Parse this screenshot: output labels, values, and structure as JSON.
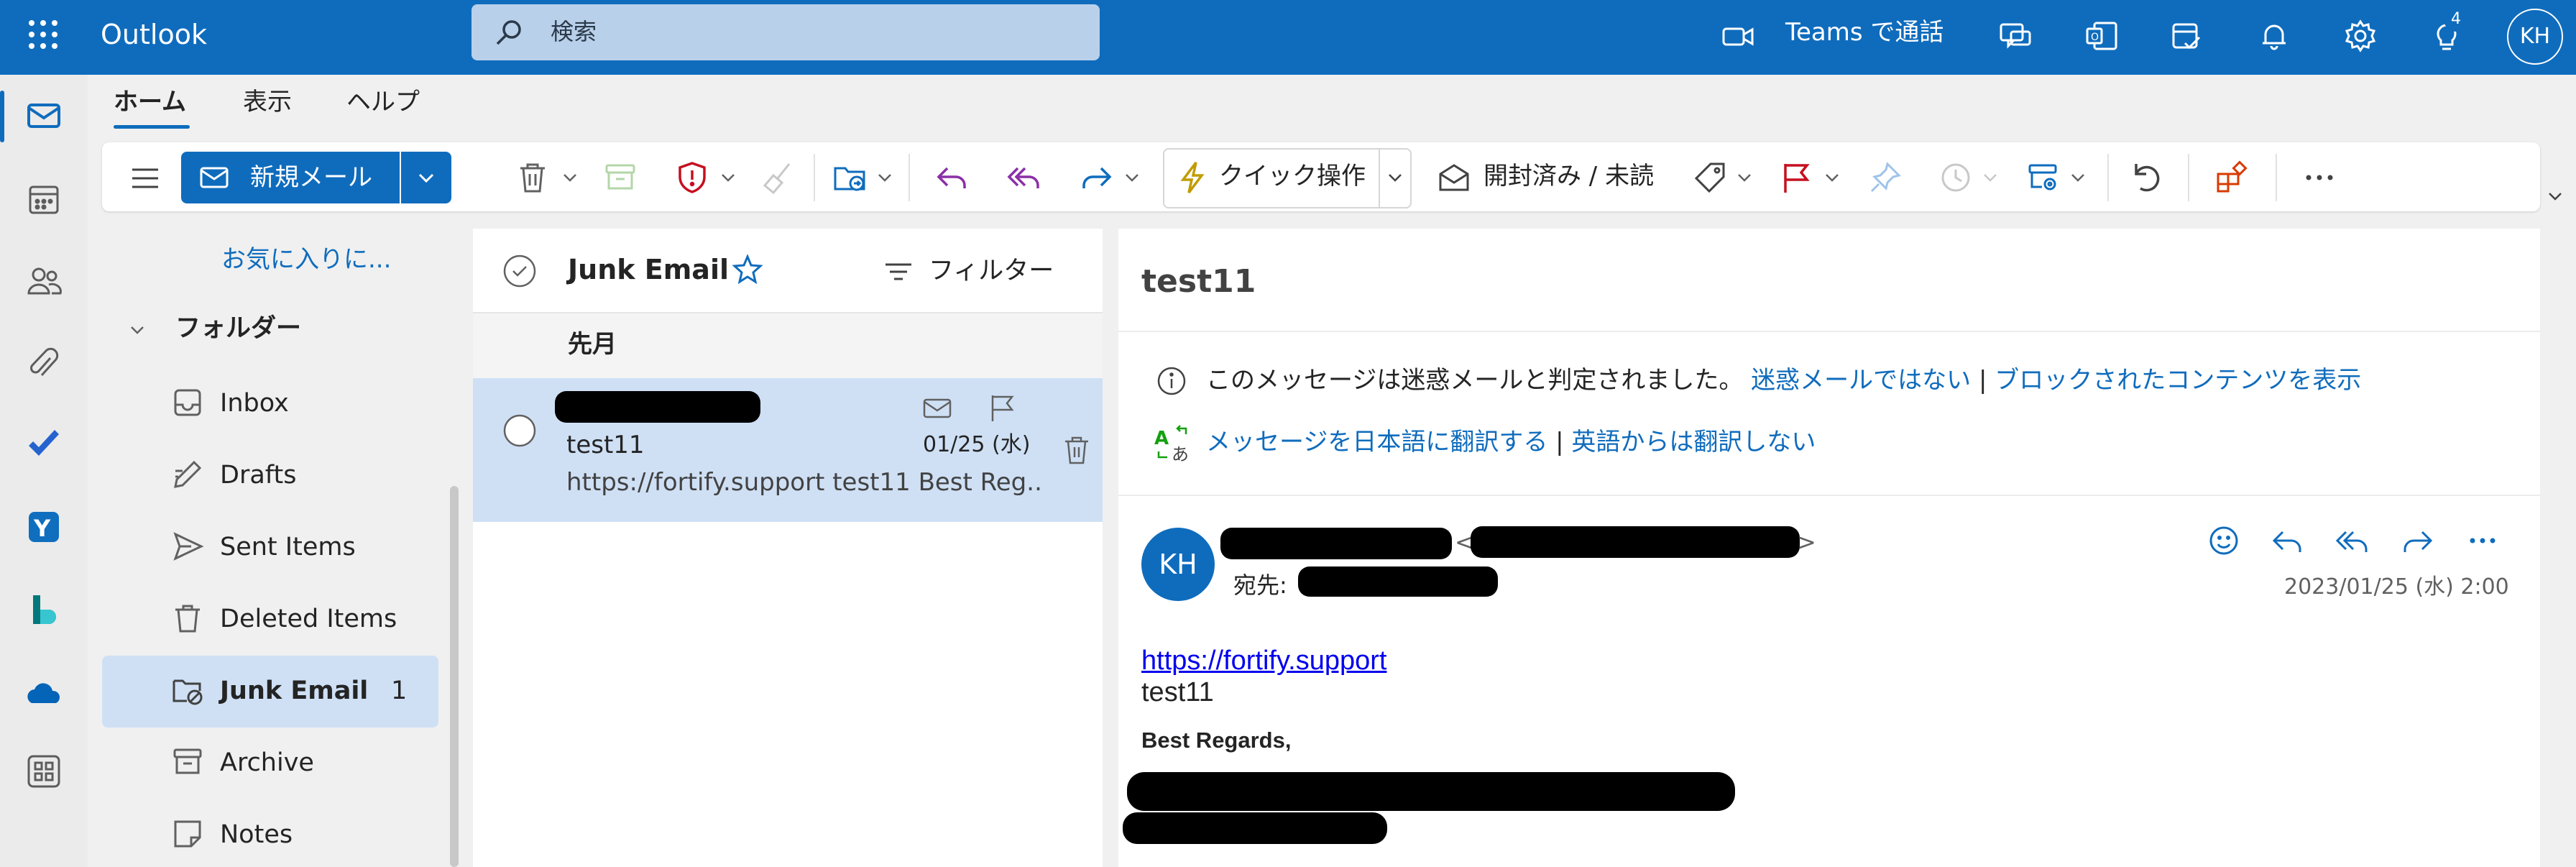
{
  "app": {
    "title": "Outlook"
  },
  "search": {
    "placeholder": "検索"
  },
  "topbar": {
    "teams_label": "Teams で通話",
    "notification_badge": "4",
    "avatar_initials": "KH"
  },
  "ribbon": {
    "tabs": [
      "ホーム",
      "表示",
      "ヘルプ"
    ],
    "new_mail_label": "新規メール",
    "quick_action_label": "クイック操作",
    "read_unread_label": "開封済み / 未読"
  },
  "folders": {
    "favorites_label": "お気に入りに...",
    "header": "フォルダー",
    "items": [
      {
        "label": "Inbox",
        "icon": "inbox-icon",
        "count": ""
      },
      {
        "label": "Drafts",
        "icon": "pencil-icon",
        "count": ""
      },
      {
        "label": "Sent Items",
        "icon": "send-icon",
        "count": ""
      },
      {
        "label": "Deleted Items",
        "icon": "trash-icon",
        "count": ""
      },
      {
        "label": "Junk Email",
        "icon": "junk-icon",
        "count": "1"
      },
      {
        "label": "Archive",
        "icon": "archive-icon",
        "count": ""
      },
      {
        "label": "Notes",
        "icon": "note-icon",
        "count": ""
      }
    ]
  },
  "message_list": {
    "title": "Junk Email",
    "filter_label": "フィルター",
    "group_label": "先月",
    "messages": [
      {
        "subject": "test11",
        "date": "01/25 (水)",
        "preview": "https://fortify.support test11 Best Reg..."
      }
    ]
  },
  "reading_pane": {
    "subject": "test11",
    "junk_notice": "このメッセージは迷惑メールと判定されました。",
    "not_junk_link": "迷惑メールではない",
    "separator": "|",
    "show_blocked_link": "ブロックされたコンテンツを表示",
    "translate_link": "メッセージを日本語に翻訳する",
    "no_translate_link": "英語からは翻訳しない",
    "sender_initials": "KH",
    "to_label": "宛先:",
    "date": "2023/01/25 (水) 2:00",
    "body": {
      "link": "https://fortify.support",
      "text": "test11",
      "signature": "Best Regards,"
    }
  },
  "colors": {
    "brand": "#0f6cbd",
    "selection": "#cfe0f5",
    "junk_red": "#c50f1f",
    "flag_red": "#c50f1f"
  }
}
